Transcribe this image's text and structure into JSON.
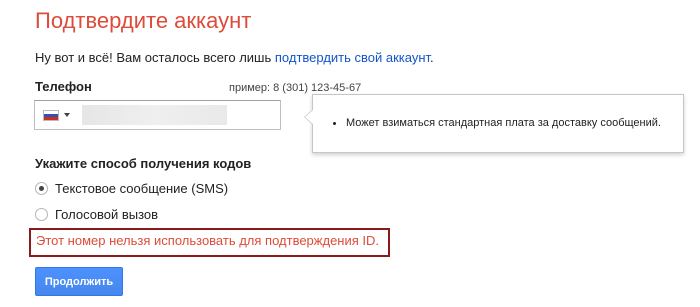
{
  "header": {
    "title": "Подтвердите аккаунт"
  },
  "intro": {
    "text_before": "Ну вот и всё! Вам осталось всего лишь ",
    "link_text": "подтвердить свой аккаунт",
    "text_after": "."
  },
  "phone": {
    "label": "Телефон",
    "example": "пример: 8 (301) 123-45-67",
    "country_flag": "russia-flag",
    "value": "",
    "value_obscured": true
  },
  "tooltip": {
    "items": [
      "Может взиматься стандартная плата за доставку сообщений."
    ]
  },
  "method": {
    "label": "Укажите способ получения кодов",
    "options": [
      {
        "label": "Текстовое сообщение (SMS)",
        "selected": true
      },
      {
        "label": "Голосовой вызов",
        "selected": false
      }
    ]
  },
  "error": {
    "text": "Этот номер нельзя использовать для подтверждения ID."
  },
  "actions": {
    "continue_label": "Продолжить"
  },
  "colors": {
    "title": "#dd4b39",
    "link": "#1155cc",
    "error_text": "#dd4b39",
    "error_border": "#8b1a1a",
    "button": "#4d90fe"
  }
}
